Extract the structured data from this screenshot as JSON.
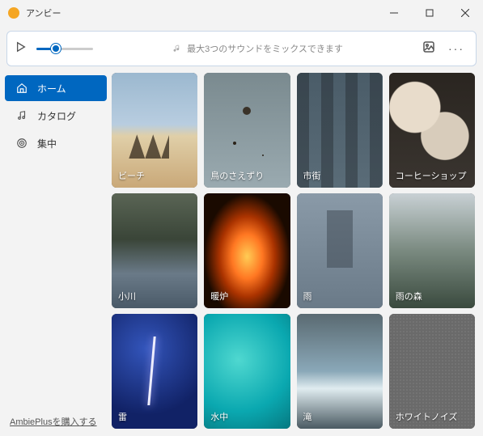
{
  "app": {
    "title": "アンビー"
  },
  "controlbar": {
    "hint": "最大3つのサウンドをミックスできます"
  },
  "sidebar": {
    "items": [
      {
        "label": "ホーム"
      },
      {
        "label": "カタログ"
      },
      {
        "label": "集中"
      }
    ],
    "purchase": "AmbiePlusを購入する"
  },
  "cards": [
    {
      "label": "ビーチ"
    },
    {
      "label": "鳥のさえずり"
    },
    {
      "label": "市街"
    },
    {
      "label": "コーヒーショップ"
    },
    {
      "label": "小川"
    },
    {
      "label": "暖炉"
    },
    {
      "label": "雨"
    },
    {
      "label": "雨の森"
    },
    {
      "label": "雷"
    },
    {
      "label": "水中"
    },
    {
      "label": "滝"
    },
    {
      "label": "ホワイトノイズ"
    }
  ]
}
